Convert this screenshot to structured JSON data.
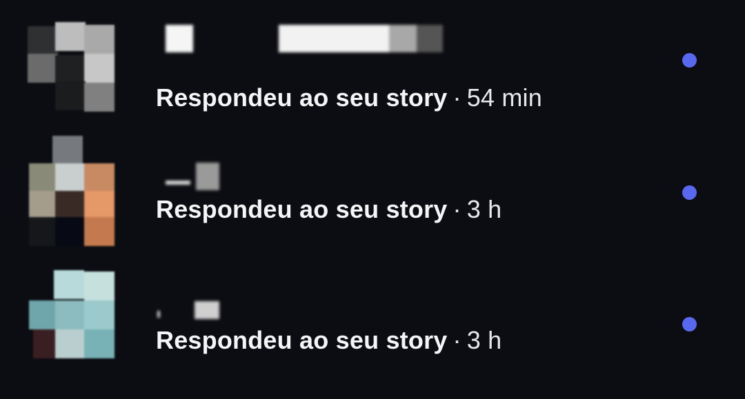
{
  "notifications": [
    {
      "action": "Respondeu ao seu story",
      "separator": "·",
      "time": "54 min",
      "unread": true
    },
    {
      "action": "Respondeu ao seu story",
      "separator": "·",
      "time": "3 h",
      "unread": true
    },
    {
      "action": "Respondeu ao seu story",
      "separator": "·",
      "time": "3 h",
      "unread": true
    }
  ],
  "colors": {
    "background": "#0b0d12",
    "text": "#f2f3f5",
    "unread_dot": "#5a68f0"
  },
  "icons": {
    "unread": "unread-dot-icon"
  }
}
